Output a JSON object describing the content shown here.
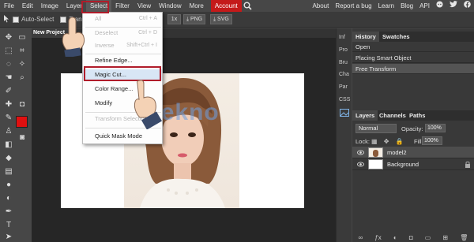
{
  "menubar": {
    "items": [
      "File",
      "Edit",
      "Image",
      "Layer",
      "Select",
      "Filter",
      "View",
      "Window",
      "More",
      "Account"
    ],
    "right": [
      "About",
      "Report a bug",
      "Learn",
      "Blog",
      "API"
    ]
  },
  "options": {
    "auto_select": "Auto-Select",
    "transform": "Transf",
    "zoom": "1x",
    "png": "PNG",
    "svg": "SVG"
  },
  "document": {
    "tab": "New Project"
  },
  "select_menu": {
    "all": "All",
    "all_sc": "Ctrl + A",
    "deselect": "Deselect",
    "deselect_sc": "Ctrl + D",
    "inverse": "Inverse",
    "inverse_sc": "Shift+Ctrl + I",
    "refine_edge": "Refine Edge...",
    "magic_cut": "Magic Cut...",
    "color_range": "Color Range...",
    "modify": "Modify",
    "transform_selection": "Transform Selection",
    "quick_mask": "Quick Mask Mode"
  },
  "narrow_panel": [
    "Inf",
    "Pro",
    "Bru",
    "Cha",
    "Par",
    "CSS"
  ],
  "history": {
    "tabs": [
      "History",
      "Swatches"
    ],
    "items": [
      "Open",
      "Placing Smart Object",
      "Free Transform"
    ]
  },
  "layers": {
    "tabs": [
      "Layers",
      "Channels",
      "Paths"
    ],
    "blend_mode": "Normal",
    "opacity_label": "Opacity:",
    "opacity": "100%",
    "lock_label": "Lock:",
    "fill_label": "Fill:",
    "fill": "100%",
    "items": [
      "model2",
      "Background"
    ]
  },
  "watermark": "sa tekno",
  "colors": {
    "accent": "#c41a1a",
    "highlight": "#b01c2a",
    "foreground": "#e01010"
  }
}
